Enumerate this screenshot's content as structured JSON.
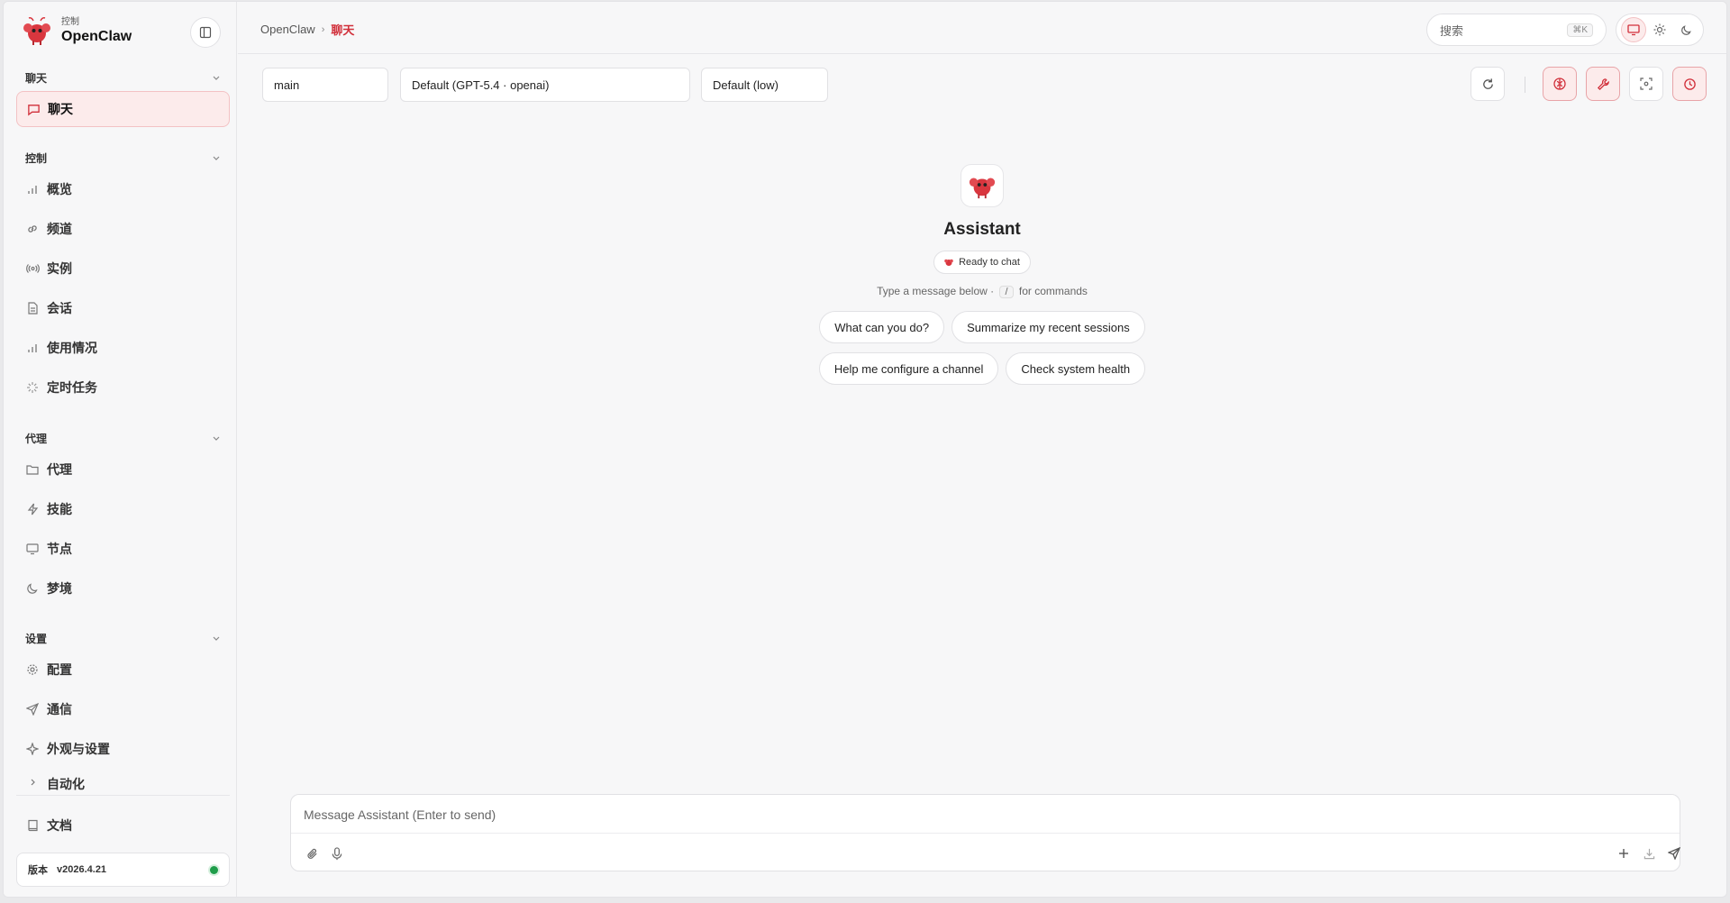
{
  "brand": {
    "sub": "控制",
    "name": "OpenClaw"
  },
  "nav": {
    "groups": [
      {
        "title": "聊天",
        "items": [
          {
            "label": "聊天",
            "icon": "chat-bubble-icon",
            "active": true
          }
        ]
      },
      {
        "title": "控制",
        "items": [
          {
            "label": "概览",
            "icon": "bar-chart-icon"
          },
          {
            "label": "频道",
            "icon": "link-icon"
          },
          {
            "label": "实例",
            "icon": "radio-icon"
          },
          {
            "label": "会话",
            "icon": "document-icon"
          },
          {
            "label": "使用情况",
            "icon": "bar-chart-icon"
          },
          {
            "label": "定时任务",
            "icon": "loader-icon"
          }
        ]
      },
      {
        "title": "代理",
        "items": [
          {
            "label": "代理",
            "icon": "folder-icon"
          },
          {
            "label": "技能",
            "icon": "zap-icon"
          },
          {
            "label": "节点",
            "icon": "monitor-icon"
          },
          {
            "label": "梦境",
            "icon": "moon-icon"
          }
        ]
      },
      {
        "title": "设置",
        "items": [
          {
            "label": "配置",
            "icon": "gear-icon"
          },
          {
            "label": "通信",
            "icon": "send-icon"
          },
          {
            "label": "外观与设置",
            "icon": "sparkle-icon"
          },
          {
            "label": "自动化",
            "icon": "chevron-right-icon"
          }
        ]
      }
    ],
    "docs": {
      "label": "文档",
      "icon": "book-icon"
    },
    "version": {
      "label": "版本",
      "value": "v2026.4.21",
      "status_color": "#1f9d4a"
    }
  },
  "topbar": {
    "breadcrumb": {
      "root": "OpenClaw",
      "sep": "›",
      "current": "聊天"
    },
    "search": {
      "placeholder": "搜索",
      "shortcut": "⌘K"
    },
    "theme": {
      "active": "system"
    }
  },
  "controls": {
    "session": "main",
    "model": "Default (GPT-5.4 · openai)",
    "thinking": "Default (low)"
  },
  "welcome": {
    "name": "Assistant",
    "status": "Ready to chat",
    "hint_before": "Type a message below ·",
    "hint_slash": "/",
    "hint_after": "for commands",
    "suggestions": [
      "What can you do?",
      "Summarize my recent sessions",
      "Help me configure a channel",
      "Check system health"
    ]
  },
  "composer": {
    "placeholder": "Message Assistant (Enter to send)"
  },
  "colors": {
    "accent": "#d12f3a",
    "accent_bg": "#fcebeb",
    "status_green": "#1f9d4a"
  }
}
